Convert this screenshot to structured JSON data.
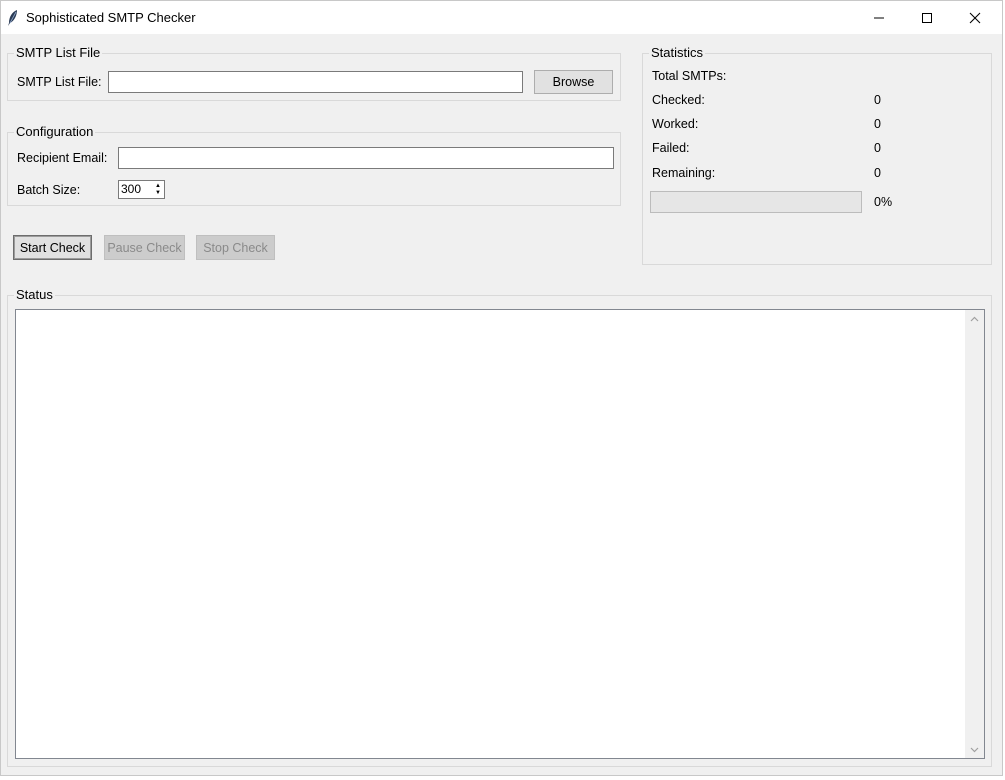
{
  "window": {
    "title": "Sophisticated SMTP Checker"
  },
  "file_group": {
    "title": "SMTP List File",
    "file_label": "SMTP List File:",
    "file_value": "",
    "browse_label": "Browse"
  },
  "config_group": {
    "title": "Configuration",
    "recipient_label": "Recipient Email:",
    "recipient_value": "",
    "batch_label": "Batch Size:",
    "batch_value": "300"
  },
  "actions": {
    "start_label": "Start Check",
    "pause_label": "Pause Check",
    "stop_label": "Stop Check"
  },
  "statistics": {
    "title": "Statistics",
    "total_label": "Total SMTPs:",
    "total_value": "",
    "checked_label": "Checked:",
    "checked_value": "0",
    "worked_label": "Worked:",
    "worked_value": "0",
    "failed_label": "Failed:",
    "failed_value": "0",
    "remaining_label": "Remaining:",
    "remaining_value": "0",
    "progress_fraction": 0,
    "progress_text": "0%"
  },
  "status_group": {
    "title": "Status",
    "log_text": ""
  },
  "icons": {
    "app": "feather-icon",
    "minimize": "minimize-icon",
    "maximize": "maximize-icon",
    "close": "close-icon",
    "scroll_up": "chevron-up-icon",
    "scroll_down": "chevron-down-icon"
  }
}
